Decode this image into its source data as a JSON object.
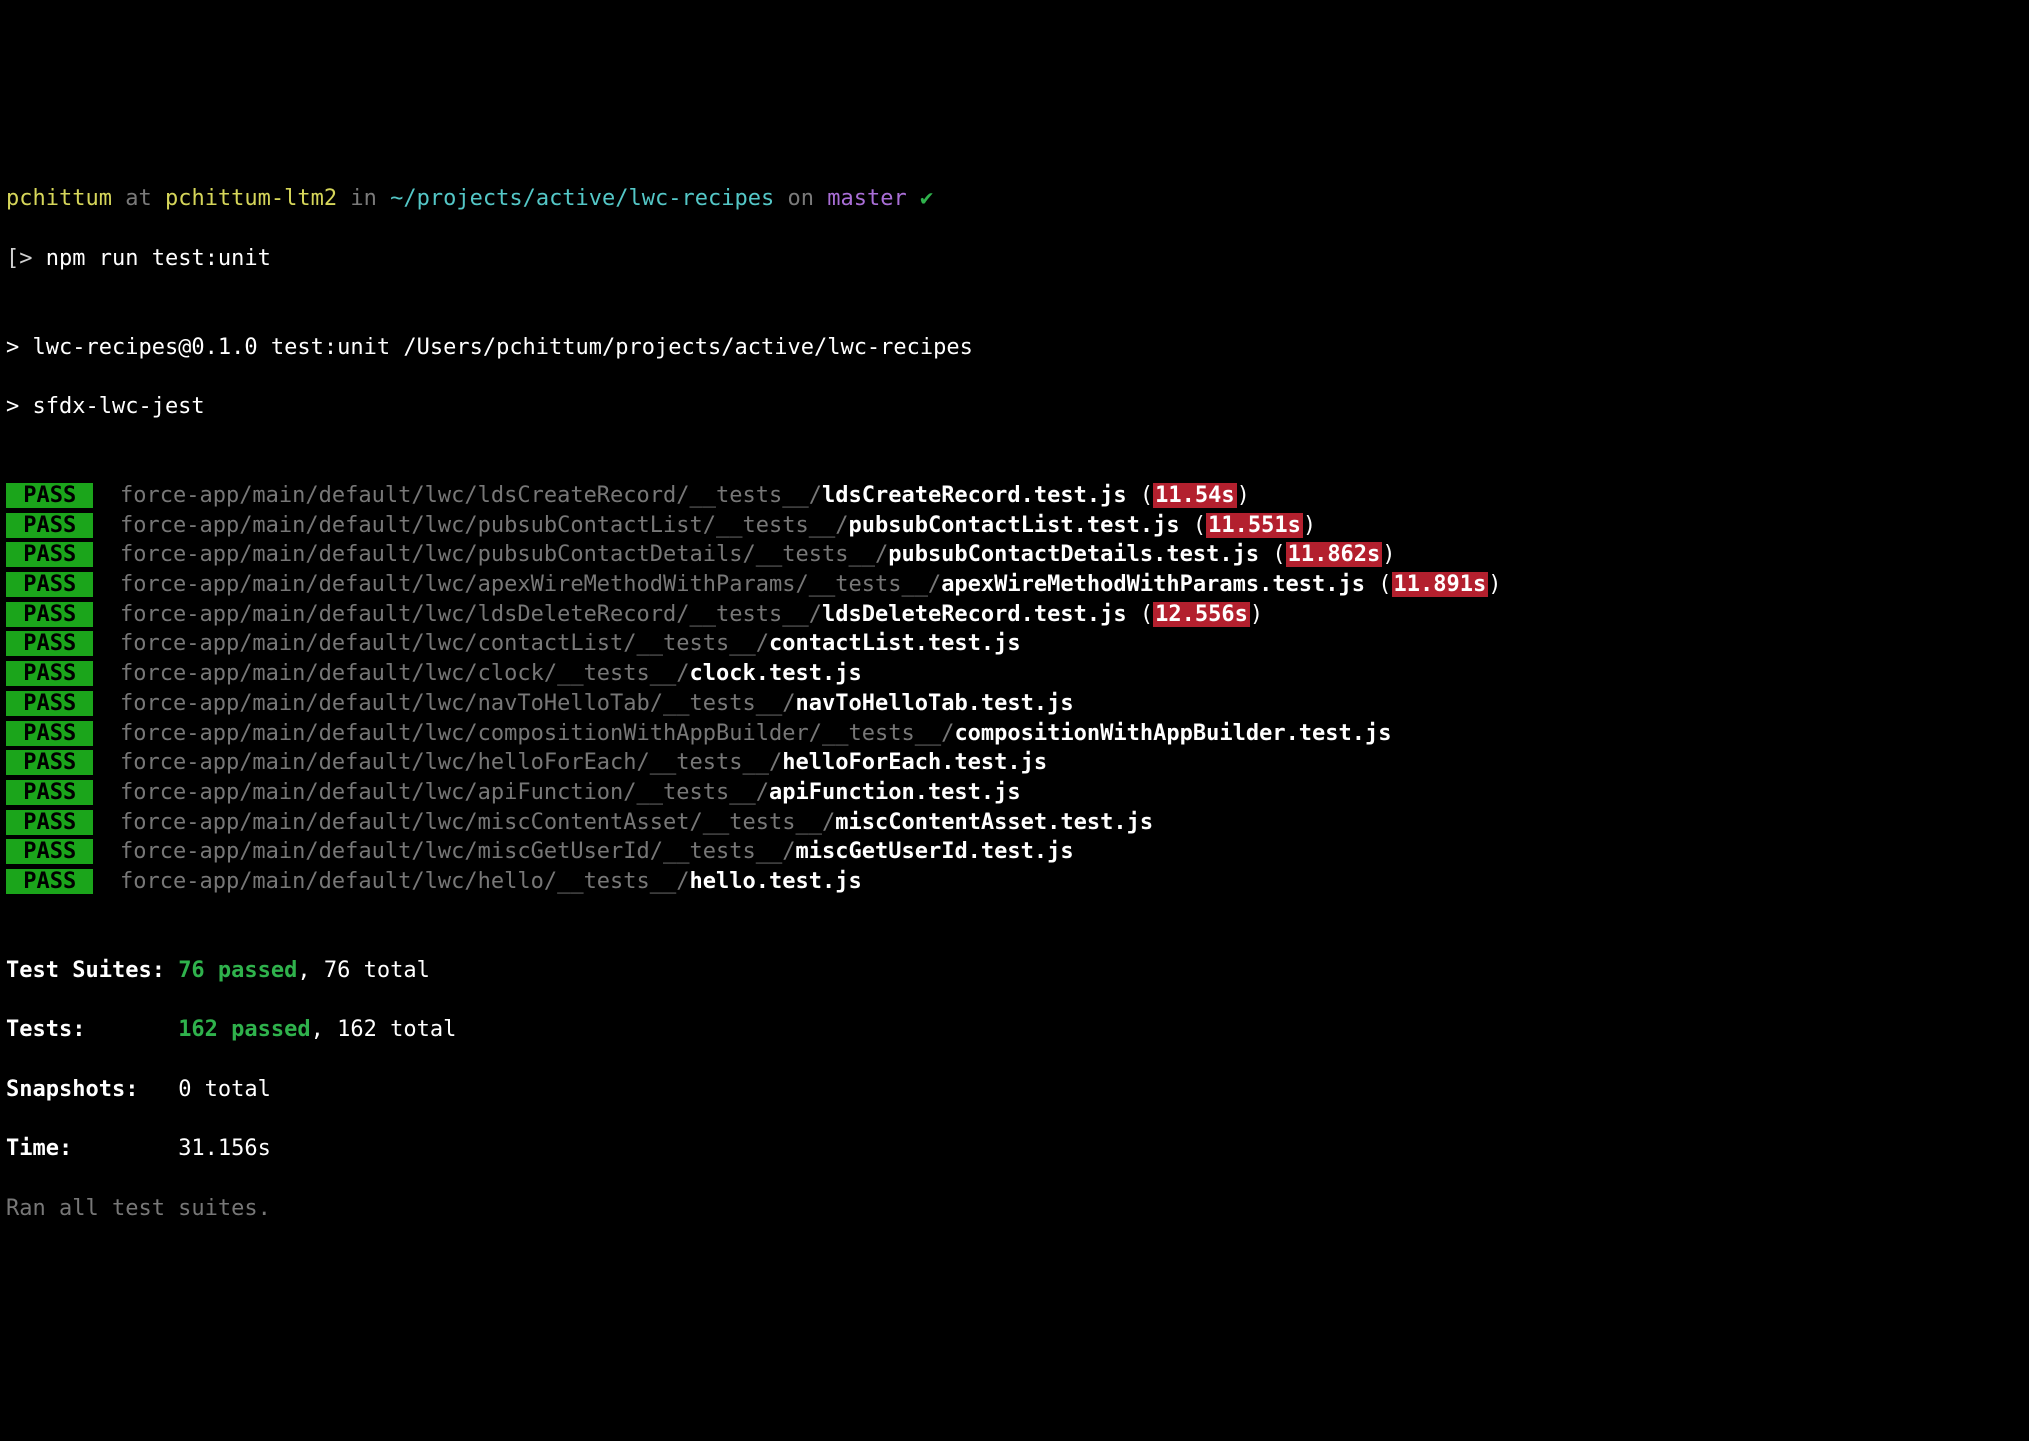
{
  "prompt": {
    "user": "pchittum",
    "at": " at ",
    "host": "pchittum-ltm2",
    "in": " in ",
    "cwd": "~/projects/active/lwc-recipes",
    "on": " on ",
    "branch": "master",
    "check": " ✔"
  },
  "cmdline": {
    "caret": "[> ",
    "cmd": "npm run test:unit"
  },
  "blank": "",
  "npm": {
    "line1": "> lwc-recipes@0.1.0 test:unit /Users/pchittum/projects/active/lwc-recipes",
    "line2": "> sfdx-lwc-jest"
  },
  "pass": " PASS ",
  "tests": [
    {
      "dir": "force-app/main/default/lwc/ldsCreateRecord/__tests__/",
      "file": "ldsCreateRecord.test.js",
      "time": "11.54s"
    },
    {
      "dir": "force-app/main/default/lwc/pubsubContactList/__tests__/",
      "file": "pubsubContactList.test.js",
      "time": "11.551s"
    },
    {
      "dir": "force-app/main/default/lwc/pubsubContactDetails/__tests__/",
      "file": "pubsubContactDetails.test.js",
      "time": "11.862s"
    },
    {
      "dir": "force-app/main/default/lwc/apexWireMethodWithParams/__tests__/",
      "file": "apexWireMethodWithParams.test.js",
      "time": "11.891s"
    },
    {
      "dir": "force-app/main/default/lwc/ldsDeleteRecord/__tests__/",
      "file": "ldsDeleteRecord.test.js",
      "time": "12.556s"
    },
    {
      "dir": "force-app/main/default/lwc/contactList/__tests__/",
      "file": "contactList.test.js",
      "time": ""
    },
    {
      "dir": "force-app/main/default/lwc/clock/__tests__/",
      "file": "clock.test.js",
      "time": ""
    },
    {
      "dir": "force-app/main/default/lwc/navToHelloTab/__tests__/",
      "file": "navToHelloTab.test.js",
      "time": ""
    },
    {
      "dir": "force-app/main/default/lwc/compositionWithAppBuilder/__tests__/",
      "file": "compositionWithAppBuilder.test.js",
      "time": ""
    },
    {
      "dir": "force-app/main/default/lwc/helloForEach/__tests__/",
      "file": "helloForEach.test.js",
      "time": ""
    },
    {
      "dir": "force-app/main/default/lwc/apiFunction/__tests__/",
      "file": "apiFunction.test.js",
      "time": ""
    },
    {
      "dir": "force-app/main/default/lwc/miscContentAsset/__tests__/",
      "file": "miscContentAsset.test.js",
      "time": ""
    },
    {
      "dir": "force-app/main/default/lwc/miscGetUserId/__tests__/",
      "file": "miscGetUserId.test.js",
      "time": ""
    },
    {
      "dir": "force-app/main/default/lwc/hello/__tests__/",
      "file": "hello.test.js",
      "time": ""
    }
  ],
  "summary": {
    "suites_label": "Test Suites: ",
    "suites_passed": "76 passed",
    "suites_total": ", 76 total",
    "tests_label": "Tests:       ",
    "tests_passed": "162 passed",
    "tests_total": ", 162 total",
    "snap_label": "Snapshots:   ",
    "snap_value": "0 total",
    "time_label": "Time:        ",
    "time_value": "31.156s",
    "ran": "Ran all test suites."
  }
}
